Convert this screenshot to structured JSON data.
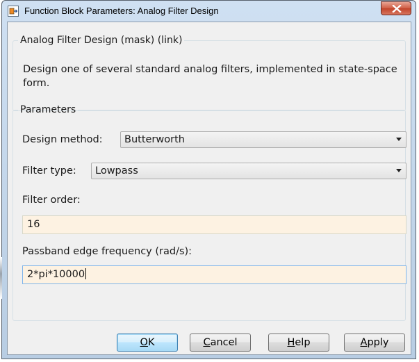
{
  "window": {
    "title": "Function Block Parameters: Analog Filter Design"
  },
  "description_group": {
    "legend": "Analog Filter Design (mask) (link)",
    "text": "Design one of several standard analog filters, implemented in state-space form."
  },
  "parameters": {
    "legend": "Parameters",
    "design_method": {
      "label": "Design method:",
      "value": "Butterworth"
    },
    "filter_type": {
      "label": "Filter type:",
      "value": "Lowpass"
    },
    "filter_order": {
      "label": "Filter order:",
      "value": "16"
    },
    "passband_edge": {
      "label": "Passband edge frequency (rad/s):",
      "value": "2*pi*10000"
    }
  },
  "buttons": {
    "ok": {
      "mnemonic": "O",
      "rest": "K"
    },
    "cancel": {
      "mnemonic": "C",
      "rest": "ancel"
    },
    "help": {
      "mnemonic": "H",
      "rest": "elp"
    },
    "apply": {
      "mnemonic": "A",
      "rest": "pply"
    }
  },
  "colors": {
    "input_bg": "#fdf2e2",
    "close_button": "#c1442a",
    "default_button": "#bee6fd"
  }
}
